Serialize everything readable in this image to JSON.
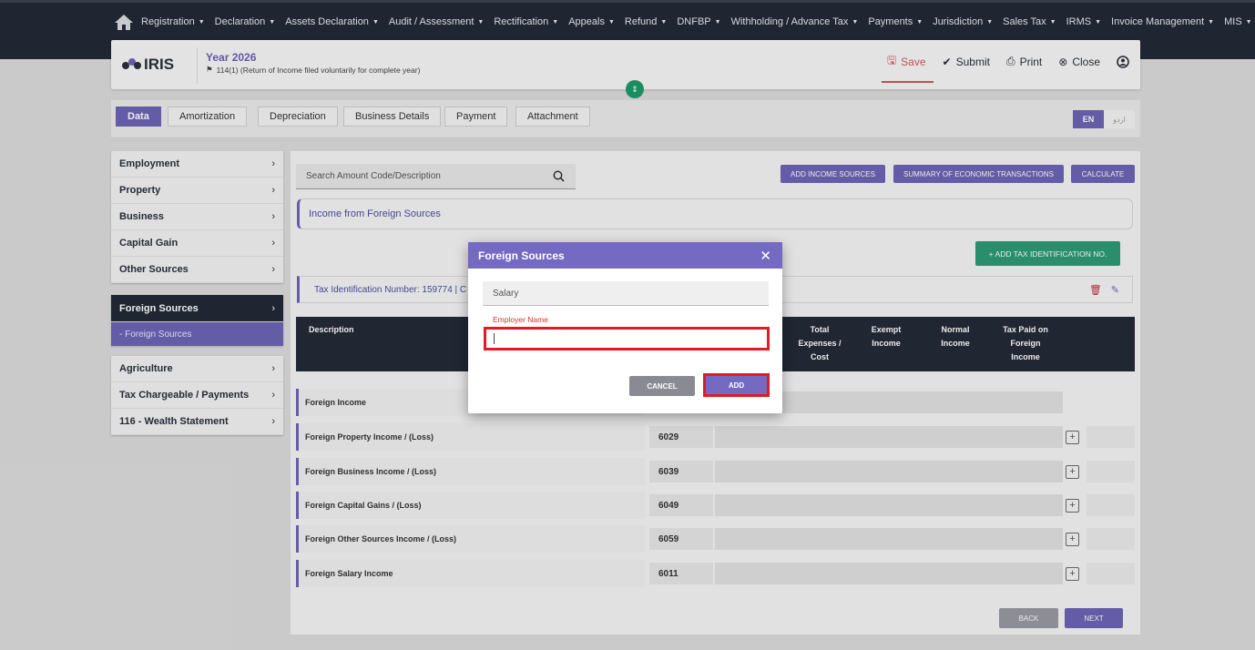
{
  "nav": {
    "items": [
      "Registration",
      "Declaration",
      "Assets Declaration",
      "Audit / Assessment",
      "Rectification",
      "Appeals",
      "Refund",
      "DNFBP",
      "Withholding / Advance Tax",
      "Payments",
      "Jurisdiction",
      "Sales Tax",
      "IRMS",
      "Invoice Management",
      "MIS"
    ]
  },
  "header": {
    "logo": "IRIS",
    "year": "Year 2026",
    "subtitle": "114(1) (Return of Income filed voluntarily for complete year)",
    "save": "Save",
    "submit": "Submit",
    "print": "Print",
    "close": "Close"
  },
  "tabs": [
    "Data",
    "Amortization",
    "Depreciation",
    "Business Details",
    "Payment",
    "Attachment"
  ],
  "lang": {
    "en": "EN",
    "ur": "اردو"
  },
  "sidebar": {
    "group1": [
      "Employment",
      "Property",
      "Business",
      "Capital Gain",
      "Other Sources"
    ],
    "active": "Foreign Sources",
    "sub": "- Foreign Sources",
    "group2": [
      "Agriculture",
      "Tax Chargeable / Payments",
      "116 - Wealth Statement"
    ]
  },
  "main": {
    "search_placeholder": "Search Amount Code/Description",
    "btn_add_income": "ADD INCOME SOURCES",
    "btn_summary": "SUMMARY OF ECONOMIC TRANSACTIONS",
    "btn_calculate": "CALCULATE",
    "section_title": "Income from Foreign Sources",
    "btn_add_tin": "+ ADD TAX IDENTIFICATION NO.",
    "tin_text": "Tax Identification Number: 159774 | C",
    "columns": {
      "description": "Description",
      "total_expenses": "Total Expenses / Cost",
      "exempt": "Exempt Income",
      "normal": "Normal Income",
      "tax_paid": "Tax Paid on Foreign Income"
    },
    "rows": [
      {
        "label": "Foreign Income",
        "code": ""
      },
      {
        "label": "Foreign Property Income / (Loss)",
        "code": "6029"
      },
      {
        "label": "Foreign Business Income / (Loss)",
        "code": "6039"
      },
      {
        "label": "Foreign Capital Gains / (Loss)",
        "code": "6049"
      },
      {
        "label": "Foreign Other Sources Income / (Loss)",
        "code": "6059"
      },
      {
        "label": "Foreign Salary Income",
        "code": "6011"
      }
    ],
    "back": "BACK",
    "next": "NEXT"
  },
  "modal": {
    "title": "Foreign Sources",
    "field_value": "Salary",
    "label": "Employer Name",
    "input_value": "",
    "cancel": "CANCEL",
    "add": "ADD"
  },
  "colors": {
    "accent": "#6e64b6",
    "nav_bg": "#222a37",
    "highlight": "#e01b24",
    "green": "#2e9b76"
  }
}
